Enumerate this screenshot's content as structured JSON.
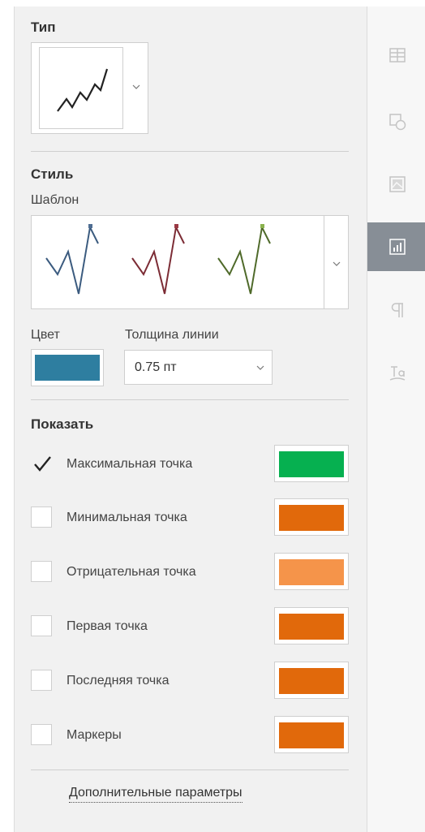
{
  "type_section": {
    "title": "Тип",
    "selected_icon": "line-sparkline-icon"
  },
  "style_section": {
    "title": "Стиль",
    "template_label": "Шаблон",
    "templates": [
      {
        "line_color": "#3b5b7f",
        "accent_color": "#4f6e93"
      },
      {
        "line_color": "#7c2c35",
        "accent_color": "#9b3a45"
      },
      {
        "line_color": "#4f6a2a",
        "accent_color": "#8bb24e"
      }
    ],
    "color_label": "Цвет",
    "color_value": "#2e7ea0",
    "weight_label": "Толщина линии",
    "weight_value": "0.75 пт"
  },
  "show_section": {
    "title": "Показать",
    "items": [
      {
        "label": "Максимальная точка",
        "checked": true,
        "color": "#06b050"
      },
      {
        "label": "Минимальная точка",
        "checked": false,
        "color": "#e1690b"
      },
      {
        "label": "Отрицательная точка",
        "checked": false,
        "color": "#f5944a"
      },
      {
        "label": "Первая точка",
        "checked": false,
        "color": "#e1690b"
      },
      {
        "label": "Последняя точка",
        "checked": false,
        "color": "#e1690b"
      },
      {
        "label": "Маркеры",
        "checked": false,
        "color": "#e1690b"
      }
    ]
  },
  "more_link": "Дополнительные параметры",
  "sidebar": {
    "items": [
      {
        "icon": "table-settings-icon",
        "active": false
      },
      {
        "icon": "shape-settings-icon",
        "active": false
      },
      {
        "icon": "image-settings-icon",
        "active": false
      },
      {
        "icon": "chart-settings-icon",
        "active": true
      },
      {
        "icon": "paragraph-settings-icon",
        "active": false
      },
      {
        "icon": "text-art-settings-icon",
        "active": false
      }
    ]
  }
}
